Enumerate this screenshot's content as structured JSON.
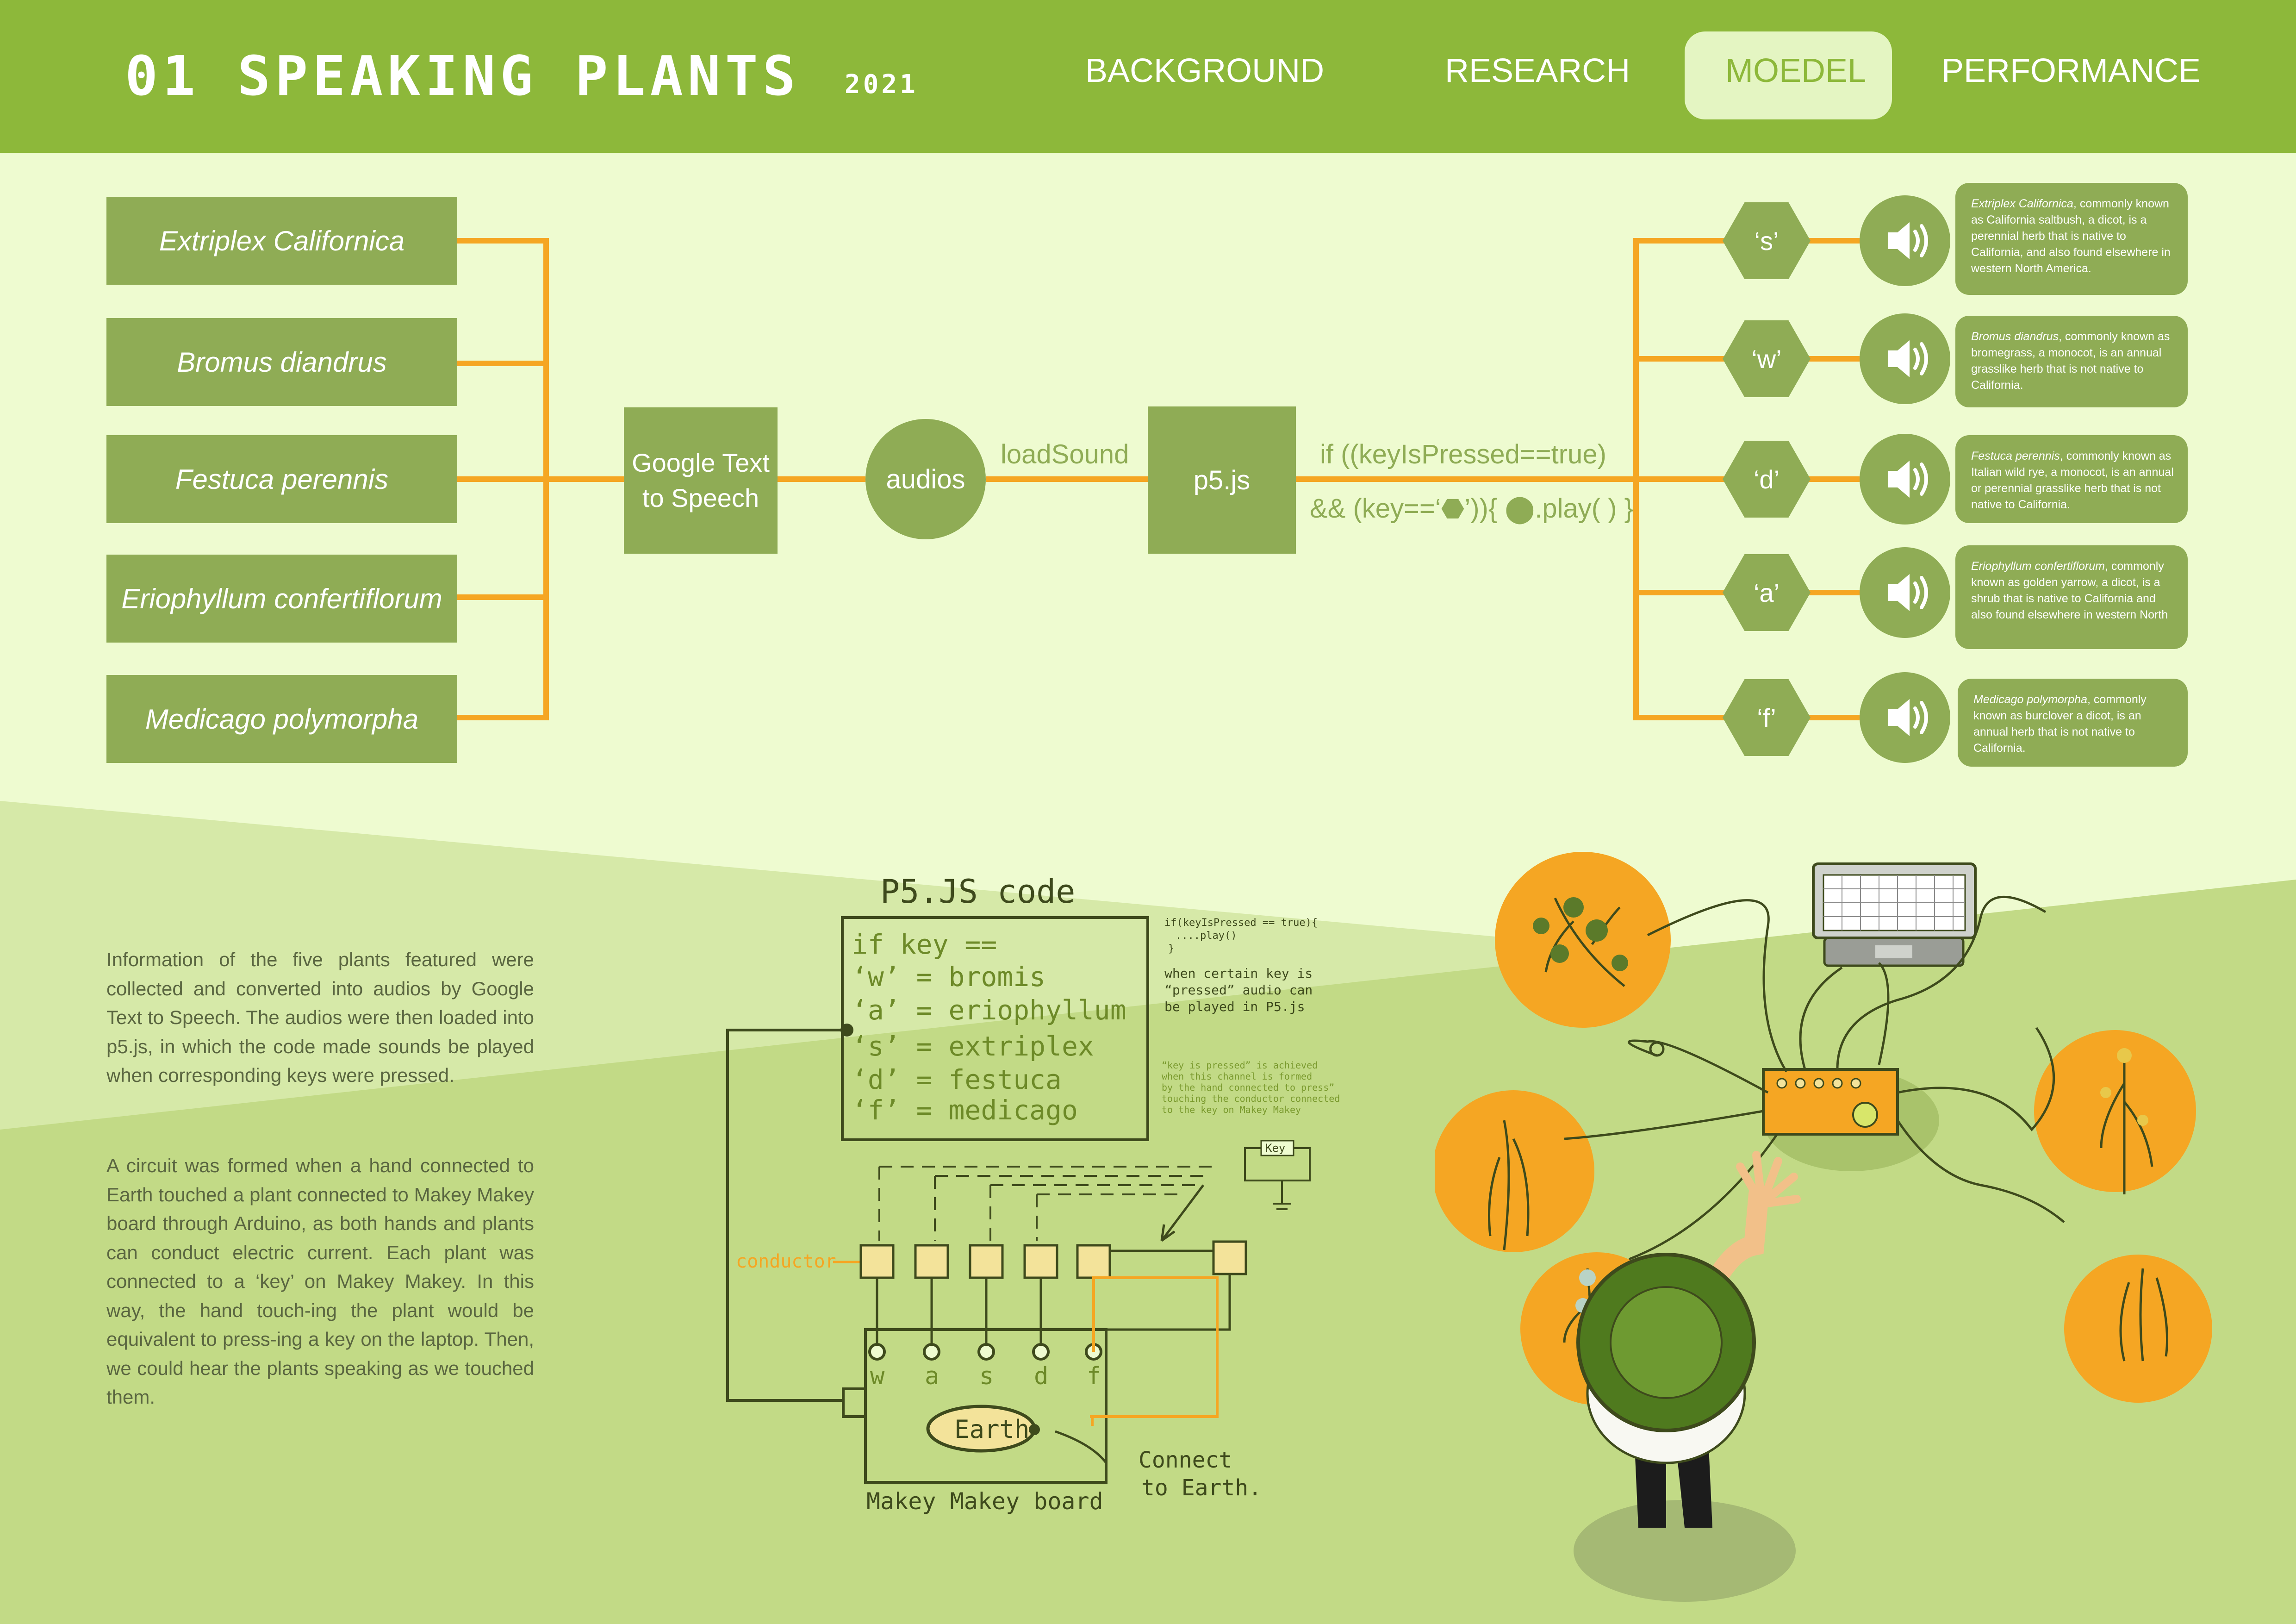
{
  "header": {
    "title": "01 SPEAKING PLANTS",
    "year": "2021",
    "nav": [
      "BACKGROUND",
      "RESEARCH",
      "MOEDEL",
      "PERFORMANCE"
    ],
    "active_nav": "MOEDEL"
  },
  "colors": {
    "header_green": "#8db83a",
    "box_green": "#8fac55",
    "connector_orange": "#f5a623",
    "background_light": "#eefbd0",
    "ground_green": "#c0d98a",
    "sketch_dark": "#3e4a1c"
  },
  "plants": [
    "Extriplex Californica",
    "Bromus diandrus",
    "Festuca perennis",
    "Eriophyllum confertiflorum",
    "Medicago polymorpha"
  ],
  "flow": {
    "tts": "Google Text to Speech",
    "audios": "audios",
    "load_sound": "loadSound",
    "p5": "p5.js",
    "code_line1": "if ((keyIsPressed==true)",
    "code_line2": "&& (key==‘⬣’)){ ⬤.play( ) }"
  },
  "keys": [
    "‘s’",
    "‘w’",
    "‘d’",
    "‘a’",
    "‘f’"
  ],
  "speaker_icon": "speaker-icon",
  "descriptions": [
    {
      "name": "Extriplex Californica",
      "text": ", commonly known as California saltbush, a dicot, is a perennial herb that is native to California, and also found elsewhere in western North America."
    },
    {
      "name": "Bromus diandrus",
      "text": ", commonly known as bromegrass, a monocot, is an annual grasslike herb that is not native to California."
    },
    {
      "name": "Festuca perennis",
      "text": ", commonly known as Italian wild rye, a monocot, is an annual or perennial grasslike herb that is not native to California."
    },
    {
      "name": "Eriophyllum confertiflorum",
      "text": ", commonly known as golden yarrow, a dicot, is a shrub that is native to California and also found elsewhere in western North"
    },
    {
      "name": "Medicago polymorpha",
      "text": ", commonly known as burclover a dicot, is an annual herb that is not native to California."
    }
  ],
  "paragraphs": [
    "Information of the five plants featured were collected and converted into audios by Google Text to Speech. The audios were then loaded into p5.js, in which the code made sounds be played when corresponding keys were pressed.",
    "A circuit was formed when a hand connected to Earth touched a plant connected to Makey Makey board through Arduino, as both hands and plants can conduct electric current. Each plant was connected to a ‘key’ on Makey Makey. In this way, the hand touch-ing the plant would be equivalent to press-ing a key on the laptop. Then, we could hear the plants speaking as we touched them."
  ],
  "sketch": {
    "title": "P5.JS code",
    "code_lines": [
      "if key ==",
      "‘w’ = bromis",
      "‘a’ = eriophyllum",
      "‘s’ = extriplex",
      "‘d’ = festuca",
      "‘f’ = medicago"
    ],
    "note_code": [
      "if(keyIsPressed == true){",
      "....play()",
      "}"
    ],
    "note_text": [
      "when certain key is",
      "“pressed” audio can",
      "be played in P5.js"
    ],
    "note_small": [
      "“key is pressed” is achieved",
      "when this channel is formed",
      "by the hand connected to press”",
      "touching the conductor connected",
      "to the key on Makey Makey"
    ],
    "key_label": "Key",
    "conductor_label": "conductor",
    "board_keys": [
      "w",
      "a",
      "s",
      "d",
      "f"
    ],
    "earth_label": "Earth",
    "connect_label": [
      "Connect",
      "to Earth."
    ],
    "board_label": "Makey Makey board"
  }
}
